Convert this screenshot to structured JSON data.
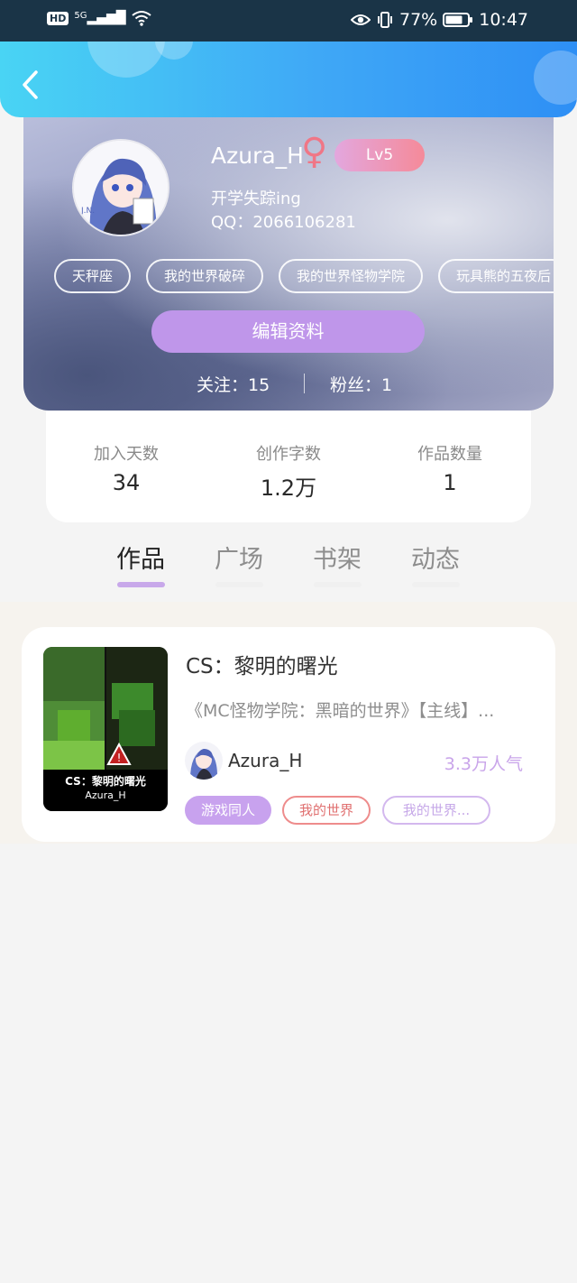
{
  "status_bar": {
    "network": "5G",
    "battery": "77%",
    "time": "10:47"
  },
  "profile": {
    "nickname": "Azura_H",
    "gender_symbol": "♀",
    "level": "Lv5",
    "bio": "开学失踪ing",
    "qq": "QQ：2066106281",
    "tags": [
      "天秤座",
      "我的世界破碎",
      "我的世界怪物学院",
      "玩具熊的五夜后"
    ],
    "edit_label": "编辑资料",
    "follow": "关注：15",
    "fans": "粉丝：1"
  },
  "stats": [
    {
      "label": "加入天数",
      "value": "34"
    },
    {
      "label": "创作字数",
      "value": "1.2万"
    },
    {
      "label": "作品数量",
      "value": "1"
    }
  ],
  "tabs": [
    {
      "label": "作品",
      "active": true
    },
    {
      "label": "广场",
      "active": false
    },
    {
      "label": "书架",
      "active": false
    },
    {
      "label": "动态",
      "active": false
    }
  ],
  "works": [
    {
      "title": "CS：黎明的曙光",
      "description": "《MC怪物学院：黑暗的世界》【主线】...",
      "author": "Azura_H",
      "popularity": "3.3万人气",
      "cover_title": "CS：黎明的曙光",
      "cover_author": "Azura_H",
      "tags": [
        "游戏同人",
        "我的世界",
        "我的世界..."
      ]
    }
  ],
  "colors": {
    "header_gradient_start": "#49d4f4",
    "header_gradient_end": "#2e8ff5",
    "accent_purple": "#bf96ea",
    "level_badge_end": "#f58a99"
  }
}
